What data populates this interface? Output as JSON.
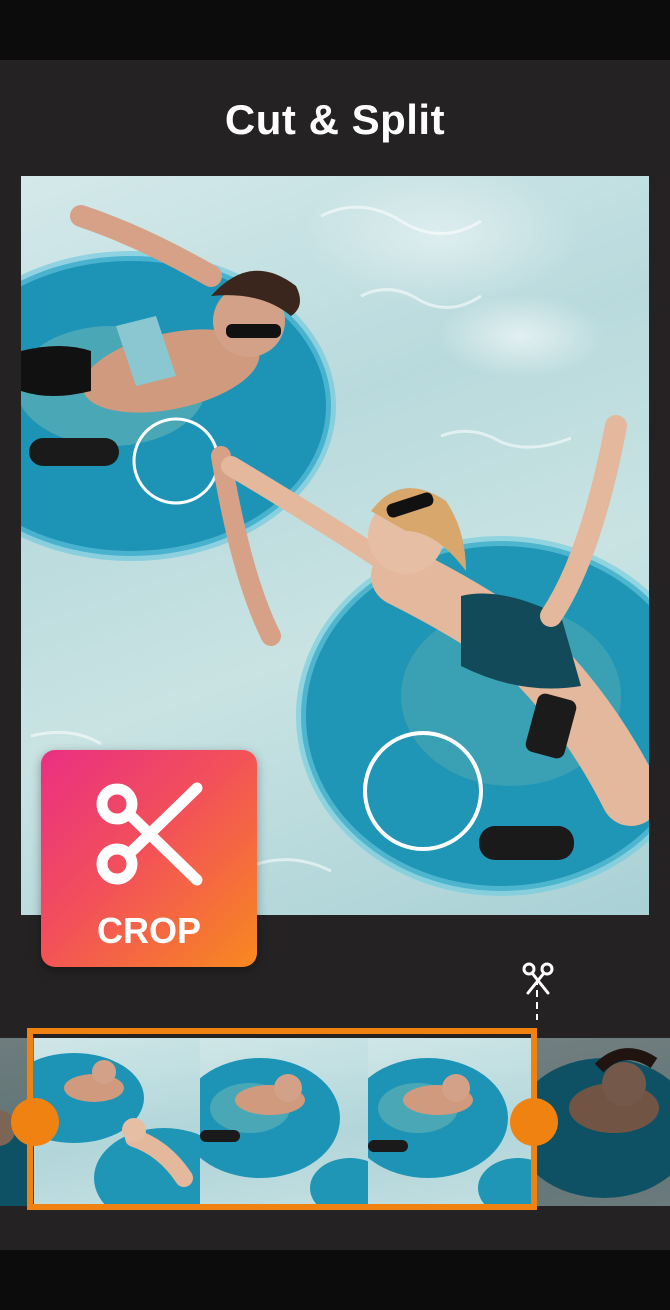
{
  "header": {
    "title": "Cut & Split"
  },
  "crop_badge": {
    "label": "CROP",
    "icon": "scissors-icon"
  },
  "split_marker": {
    "icon": "scissors-icon"
  },
  "timeline": {
    "frame_count": 4,
    "selection_color": "#f08211"
  },
  "colors": {
    "background": "#242223",
    "accent": "#f08211",
    "badge_gradient_start": "#ea2f83",
    "badge_gradient_end": "#f8891f"
  }
}
